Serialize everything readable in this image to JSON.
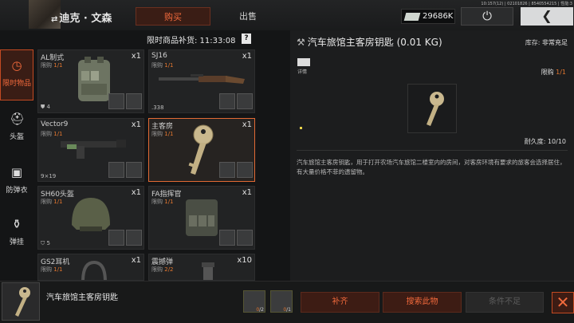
{
  "header": {
    "player_name": "迪克 · 文森",
    "tabs": {
      "buy": "购买",
      "sell": "出售"
    },
    "sys_info": "10:157(12) | 02101826 | 8540554215 | 性能:3",
    "currency_amount": "29686K",
    "power_icon": "⏻",
    "back_icon": "❮",
    "swap_icon": "⇄"
  },
  "timer": {
    "label": "限时商品补货: 11:33:08",
    "help": "?"
  },
  "categories": [
    {
      "label": "限时物品",
      "icon": "clock-icon",
      "glyph": "◷"
    },
    {
      "label": "头盔",
      "icon": "helmet-icon",
      "glyph": "⛑"
    },
    {
      "label": "防弹衣",
      "icon": "vest-icon",
      "glyph": "▣"
    },
    {
      "label": "弹挂",
      "icon": "rig-icon",
      "glyph": "⚱"
    }
  ],
  "limit_prefix": "限购",
  "items": [
    {
      "name": "AL制式",
      "qty": "x1",
      "limit": "1/1",
      "stat": "4"
    },
    {
      "name": "SJ16",
      "qty": "x1",
      "limit": "1/1",
      "stat": ".338"
    },
    {
      "name": "Vector9",
      "qty": "x1",
      "limit": "1/1",
      "stat": "9×19"
    },
    {
      "name": "主客房",
      "qty": "x1",
      "limit": "1/1",
      "stat": ""
    },
    {
      "name": "SH60头盔",
      "qty": "x1",
      "limit": "1/1",
      "stat": "5"
    },
    {
      "name": "FA指挥官",
      "qty": "x1",
      "limit": "1/1",
      "stat": ""
    },
    {
      "name": "GS2耳机",
      "qty": "x1",
      "limit": "1/1",
      "stat": ""
    },
    {
      "name": "震撼弹",
      "qty": "x10",
      "limit": "2/2",
      "stat": ""
    }
  ],
  "detail": {
    "title": "汽车旅馆主客房钥匙 (0.01 KG)",
    "stock_label": "库存: ",
    "stock_value": "非常充足",
    "info_label": "详情",
    "limit_label": "限购 ",
    "limit_value": "1/1",
    "durability": "耐久度: 10/10",
    "description": "汽车旅馆主客房钥匙，用于打开农场汽车旅馆二楼室内的房间，对客房环境有要求的旅客会选择居住，有大量价格不菲的遗留物。"
  },
  "footer": {
    "item_name": "汽车旅馆主客房钥匙",
    "requirements": [
      {
        "have": "0",
        "need": "/2"
      },
      {
        "have": "0",
        "need": "/1"
      }
    ],
    "restock": "补齐",
    "search": "搜索此物",
    "insufficient": "条件不足",
    "close_icon": "✕"
  },
  "colors": {
    "accent": "#f26a3c",
    "limit": "#e2762f",
    "selected_border": "#e26a34"
  }
}
